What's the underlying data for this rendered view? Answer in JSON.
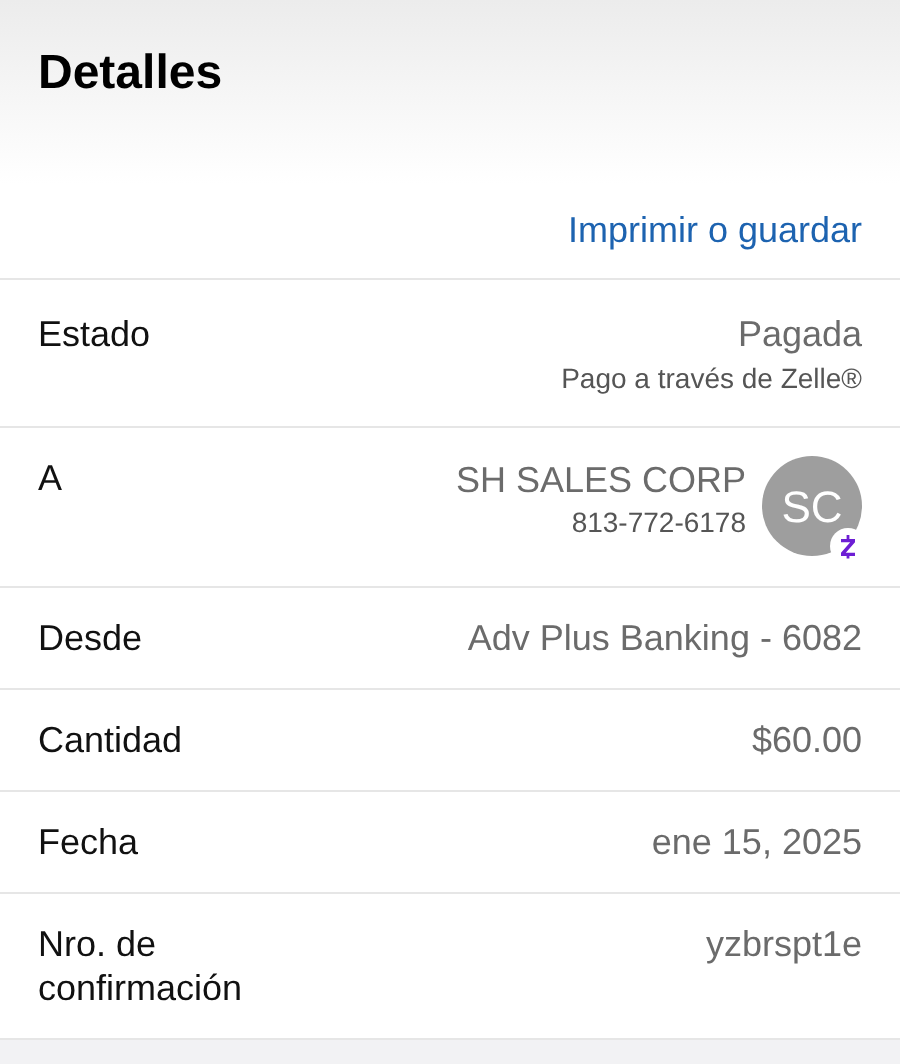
{
  "header": {
    "title": "Detalles"
  },
  "print_link": "Imprimir o guardar",
  "rows": [
    {
      "kind": "status",
      "label": "Estado",
      "value": "Pagada",
      "note": "Pago a través de Zelle®"
    },
    {
      "kind": "contact",
      "label": "A",
      "value": "SH SALES CORP",
      "note": "813-772-6178",
      "initials": "SC"
    },
    {
      "kind": "plain",
      "label": "Desde",
      "value": "Adv Plus Banking - 6082"
    },
    {
      "kind": "plain",
      "label": "Cantidad",
      "value": "$60.00"
    },
    {
      "kind": "plain",
      "label": "Fecha",
      "value": "ene 15, 2025"
    },
    {
      "kind": "plain",
      "label": "Nro. de confirmación",
      "value": "yzbrspt1e"
    }
  ]
}
